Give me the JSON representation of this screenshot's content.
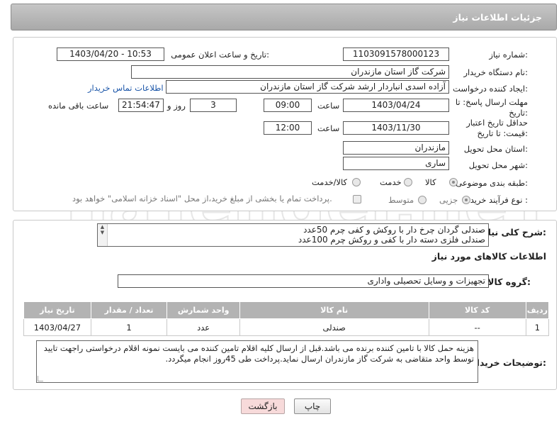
{
  "header": {
    "title": "جزئیات اطلاعات نیاز"
  },
  "form": {
    "need_number_label": "شماره نیاز:",
    "need_number": "1103091578000123",
    "announce_label": "تاریخ و ساعت اعلان عمومی:",
    "announce_value": "1403/04/20 - 10:53",
    "buyer_label": "نام دستگاه خریدار:",
    "buyer_value": "شرکت گاز استان مازندران",
    "creator_label": "ایجاد کننده درخواست:",
    "creator_value": "آزاده اسدی انباردار ارشد شرکت گاز استان مازندران",
    "contact_link": "اطلاعات تماس خریدار",
    "reply_deadline_label": "مهلت ارسال پاسخ: تا تاریخ:",
    "reply_date": "1403/04/24",
    "time_label": "ساعت",
    "reply_time": "09:00",
    "days_value": "3",
    "days_label": "روز و",
    "remaining_time": "21:54:47",
    "remaining_label": "ساعت باقی مانده",
    "price_validity_label": "حداقل تاریخ اعتبار قیمت: تا تاریخ:",
    "price_date": "1403/11/30",
    "price_time_label": "ساعت",
    "price_time": "12:00",
    "province_label": "استان محل تحویل:",
    "province_value": "مازندران",
    "city_label": "شهر محل تحویل:",
    "city_value": "ساری",
    "category_label": "طبقه بندی موضوعی:",
    "category_options": [
      "کالا",
      "خدمت",
      "کالا/خدمت"
    ],
    "process_label": "نوع فرآیند خرید :",
    "process_options": [
      "جزیی",
      "متوسط"
    ],
    "payment_note": "پرداخت تمام یا بخشی از مبلغ خرید،از محل \"اسناد خزانه اسلامی\" خواهد بود."
  },
  "description": {
    "label": "شرح کلی نیاز:",
    "line1": "صندلی گردان چرخ دار با روکش و کفی چرم 50عدد",
    "line2": "صندلی فلزی دسته دار با کفی و روکش چرم 100عدد"
  },
  "goods": {
    "section_title": "اطلاعات کالاهای مورد نیاز",
    "group_label": "گروه کالا:",
    "group_value": "تجهیزات و وسایل تحصیلی واداری",
    "columns": [
      "ردیف",
      "کد کالا",
      "نام کالا",
      "واحد شمارش",
      "تعداد / مقدار",
      "تاریخ نیاز"
    ],
    "rows": [
      [
        "1",
        "--",
        "صندلی",
        "عدد",
        "1",
        "1403/04/27"
      ]
    ]
  },
  "buyer_notes": {
    "label": "توضیحات خریدار:",
    "text": "هزینه حمل کالا با تامین کننده برنده می باشد.قبل از ارسال کلیه اقلام تامین کننده می بایست نمونه اقلام درخواستی راجهت تایید توسط واحد متقاضی به شرکت گاز مازندران ارسال نماید.پرداخت طی 45روز انجام میگردد."
  },
  "buttons": {
    "print": "چاپ",
    "back": "بازگشت"
  },
  "watermark_text": "AriaTender.neT"
}
